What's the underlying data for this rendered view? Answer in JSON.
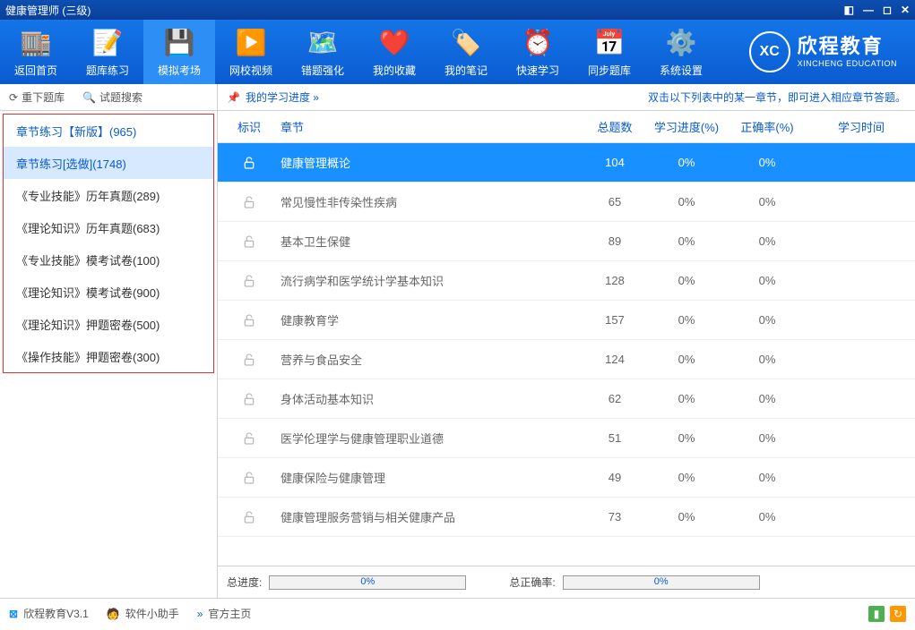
{
  "title": "健康管理师 (三级)",
  "toolbar": [
    {
      "label": "返回首页"
    },
    {
      "label": "题库练习"
    },
    {
      "label": "模拟考场"
    },
    {
      "label": "网校视频"
    },
    {
      "label": "错题强化"
    },
    {
      "label": "我的收藏"
    },
    {
      "label": "我的笔记"
    },
    {
      "label": "快速学习"
    },
    {
      "label": "同步题库"
    },
    {
      "label": "系统设置"
    }
  ],
  "brand": {
    "cn": "欣程教育",
    "en": "XINCHENG EDUCATION",
    "abbr": "XC"
  },
  "side_header": {
    "download": "重下题库",
    "search": "试题搜索"
  },
  "sidebar_items": [
    {
      "label": "章节练习【新版】(965)",
      "link": true
    },
    {
      "label": "章节练习[选做](1748)",
      "sel": true
    },
    {
      "label": "《专业技能》历年真题(289)"
    },
    {
      "label": "《理论知识》历年真题(683)"
    },
    {
      "label": "《专业技能》模考试卷(100)"
    },
    {
      "label": "《理论知识》模考试卷(900)"
    },
    {
      "label": "《理论知识》押题密卷(500)"
    },
    {
      "label": "《操作技能》押题密卷(300)"
    }
  ],
  "content_header": {
    "progress": "我的学习进度",
    "hint": "双击以下列表中的某一章节，即可进入相应章节答题。"
  },
  "columns": {
    "flag": "标识",
    "chapter": "章节",
    "total": "总题数",
    "progress": "学习进度(%)",
    "accuracy": "正确率(%)",
    "time": "学习时间"
  },
  "rows": [
    {
      "chapter": "健康管理概论",
      "total": "104",
      "prog": "0%",
      "acc": "0%",
      "active": true
    },
    {
      "chapter": "常见慢性非传染性疾病",
      "total": "65",
      "prog": "0%",
      "acc": "0%"
    },
    {
      "chapter": "基本卫生保健",
      "total": "89",
      "prog": "0%",
      "acc": "0%"
    },
    {
      "chapter": "流行病学和医学统计学基本知识",
      "total": "128",
      "prog": "0%",
      "acc": "0%"
    },
    {
      "chapter": "健康教育学",
      "total": "157",
      "prog": "0%",
      "acc": "0%"
    },
    {
      "chapter": "营养与食品安全",
      "total": "124",
      "prog": "0%",
      "acc": "0%"
    },
    {
      "chapter": "身体活动基本知识",
      "total": "62",
      "prog": "0%",
      "acc": "0%"
    },
    {
      "chapter": "医学伦理学与健康管理职业道德",
      "total": "51",
      "prog": "0%",
      "acc": "0%"
    },
    {
      "chapter": "健康保险与健康管理",
      "total": "49",
      "prog": "0%",
      "acc": "0%"
    },
    {
      "chapter": "健康管理服务营销与相关健康产品",
      "total": "73",
      "prog": "0%",
      "acc": "0%"
    }
  ],
  "footer": {
    "total_prog_label": "总进度:",
    "total_prog_val": "0%",
    "total_acc_label": "总正确率:",
    "total_acc_val": "0%"
  },
  "status": {
    "app": "欣程教育V3.1",
    "helper": "软件小助手",
    "home": "官方主页"
  }
}
